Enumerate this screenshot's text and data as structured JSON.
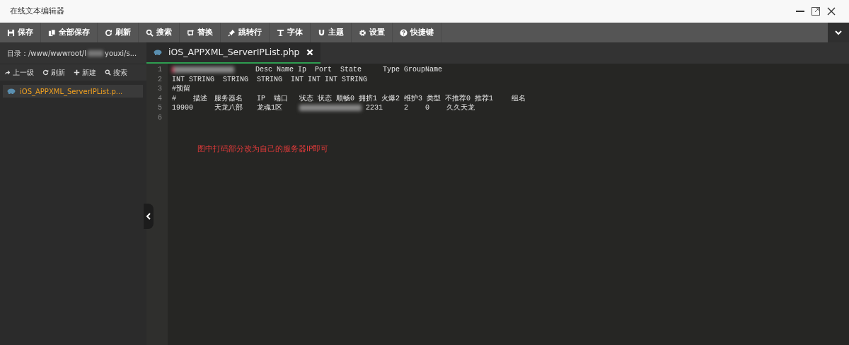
{
  "window": {
    "title": "在线文本编辑器"
  },
  "toolbar": [
    {
      "label": "保存"
    },
    {
      "label": "全部保存"
    },
    {
      "label": "刷新"
    },
    {
      "label": "搜索"
    },
    {
      "label": "替换"
    },
    {
      "label": "跳转行"
    },
    {
      "label": "字体"
    },
    {
      "label": "主题"
    },
    {
      "label": "设置"
    },
    {
      "label": "快捷键"
    }
  ],
  "sidebar": {
    "path_start": "目录：/www/wwwroot/l",
    "path_end": "youxi/s...",
    "actions": [
      {
        "label": "上一级"
      },
      {
        "label": "刷新"
      },
      {
        "label": "新建"
      },
      {
        "label": "搜索"
      }
    ],
    "files": [
      {
        "name": "iOS_APPXML_ServerIPList.p...",
        "selected": true
      }
    ]
  },
  "tabs": [
    {
      "label": "iOS_APPXML_ServerIPList.php",
      "selected": true
    }
  ],
  "editor": {
    "lines": [
      {
        "number": "1",
        "segments": [
          {
            "kind": "blur"
          },
          {
            "kind": "text",
            "text": "\tDesc\tName\tIp  Port\tState\tType\tGroupName"
          }
        ]
      },
      {
        "number": "2",
        "segments": [
          {
            "kind": "text",
            "text": "INT STRING  STRING  STRING  INT INT INT STRING"
          }
        ]
      },
      {
        "number": "3",
        "segments": [
          {
            "kind": "text",
            "text": "#预留"
          }
        ]
      },
      {
        "number": "4",
        "segments": [
          {
            "kind": "text",
            "text": "#\t描述\t服务器名\tIP  端口\t状态 状态 顺畅0 拥挤1 火爆2 维护3\t类型 不推荐0 推荐1\t组名"
          }
        ]
      },
      {
        "number": "5",
        "segments": [
          {
            "kind": "text",
            "text": "19900\t天龙八部\t龙魂1区\t"
          },
          {
            "kind": "blur"
          },
          {
            "kind": "text",
            "text": " 2231\t2\t0\t久久天龙"
          }
        ]
      },
      {
        "number": "6"
      }
    ],
    "note": "图中打码部分改为自己的服务器IP即可"
  }
}
